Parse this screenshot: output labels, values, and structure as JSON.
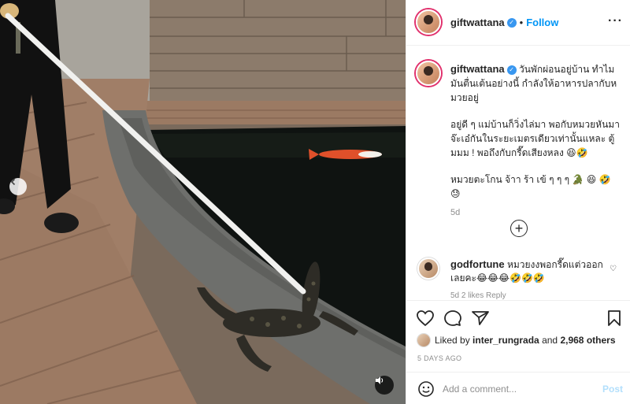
{
  "header": {
    "username": "giftwattana",
    "dot": "•",
    "follow_label": "Follow",
    "more_label": "···"
  },
  "caption": {
    "username": "giftwattana",
    "line1": "วันพักผ่อนอยู่บ้าน ทำไมมันตื่นเต้นอย่างนี้ กำลังให้อาหารปลากับหมวยอยู่",
    "line2": "อยู่ดี ๆ แม่บ้านก็วิ่งไล่มา พอกับหมวยหันมา จ๊ะเอ๋กันในระยะเมตรเดียวเท่านั้นแหละ ตู้มมม ! พอถึงกับกรี๊ดเสียงหลง 😆🤣",
    "line3": "หมวยตะโกน จ้าา ร้า เข้ ๆ ๆ ๆ 🐊 😆 🤣 😓",
    "time": "5d"
  },
  "load_more_label": "+",
  "comment": {
    "username": "godfortune",
    "text": "หมวยงงพอกรี๊ดแต่วออกเลยคะ😂😂😂🤣🤣🤣",
    "meta": "5d   2 likes   Reply"
  },
  "likes": {
    "prefix": "Liked by ",
    "user": "inter_rungrada",
    "middle": " and ",
    "count": "2,968 others"
  },
  "date": "5 DAYS AGO",
  "add_comment": {
    "placeholder": "Add a comment...",
    "post_label": "Post"
  },
  "colors": {
    "accent": "#0095f6",
    "post_disabled": "#b2dffc",
    "verified": "#3897f0",
    "muted": "#8e8e8e"
  },
  "icons": [
    "heart-icon",
    "comment-icon",
    "share-icon",
    "bookmark-icon",
    "emoji-icon",
    "sound-icon",
    "more-icon",
    "plus-circle-icon"
  ]
}
